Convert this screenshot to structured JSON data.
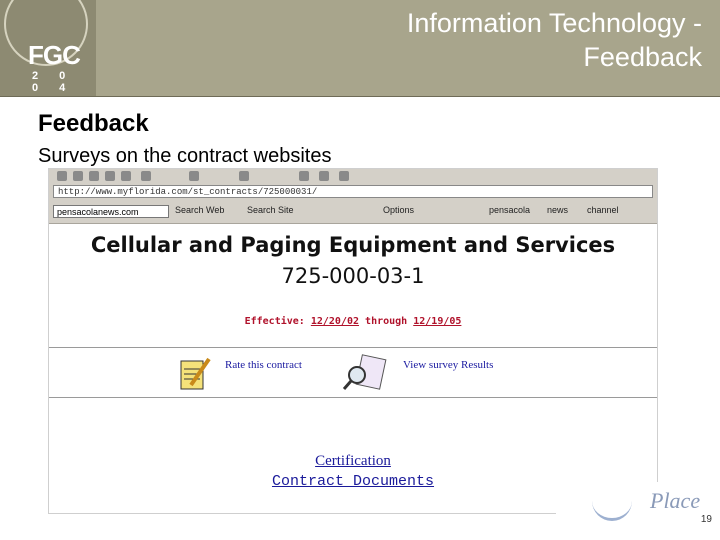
{
  "header": {
    "title_line1": "Information Technology -",
    "title_line2": "Feedback",
    "logo_text": "FGC",
    "logo_year": "2 0 0 4",
    "bg_color": "#a8a58c"
  },
  "slide": {
    "heading": "Feedback",
    "subheading": "Surveys on the contract websites",
    "page_number": "19",
    "brand_word": "Place"
  },
  "browser": {
    "address": "http://www.myflorida.com/st_contracts/725000031/",
    "toolbar_combo": "pensacolanews.com",
    "toolbar_items": [
      "Search Web",
      "Search Site",
      "Options",
      "pensacola",
      "news",
      "channel"
    ]
  },
  "contract_page": {
    "title": "Cellular and Paging Equipment and Services",
    "number": "725-000-03-1",
    "effective_label": "Effective:",
    "effective_start": "12/20/02",
    "effective_through": "through",
    "effective_end": "12/19/05",
    "rate_link": "Rate this contract",
    "results_link": "View survey Results",
    "certification_link": "Certification",
    "documents_link": "Contract Documents",
    "effective_color": "#b0122b",
    "link_color": "#1a1a9a"
  }
}
